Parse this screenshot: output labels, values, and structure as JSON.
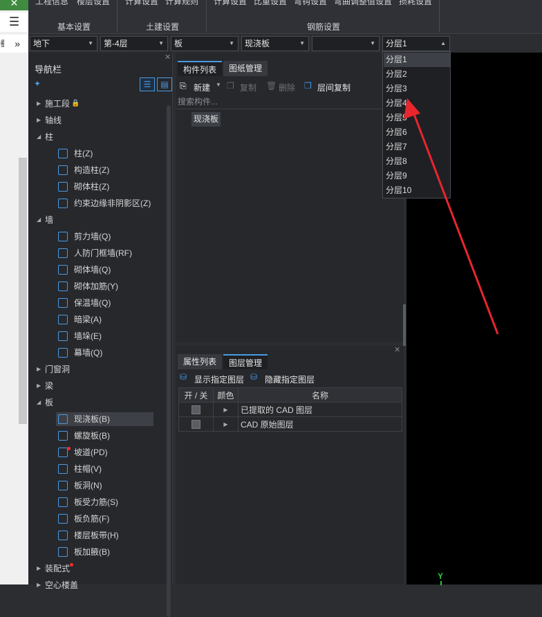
{
  "ribbon": {
    "top_items": [
      "工程信息",
      "楼层设置",
      "计算设置",
      "计算规则",
      "计算设置",
      "比重设置",
      "弯钩设置",
      "弯曲调整值设置",
      "损耗设置"
    ],
    "groups": [
      "基本设置",
      "土建设置",
      "钢筋设置"
    ]
  },
  "left_strip": {
    "top_icon": "✕",
    "menu_icon": "☰",
    "more_icon": "»",
    "edge_text": "垂"
  },
  "selectors": {
    "floor_type": "地下",
    "floor": "第-4层",
    "category": "板",
    "component": "现浇板",
    "empty": "",
    "sublayer": "分层1"
  },
  "dropdown_options": [
    "分层1",
    "分层2",
    "分层3",
    "分层4",
    "分层5",
    "分层6",
    "分层7",
    "分层8",
    "分层9",
    "分层10"
  ],
  "nav": {
    "title": "导航栏",
    "tree": [
      {
        "label": "施工段",
        "level": 0,
        "expanded": false,
        "suffix": "🔒"
      },
      {
        "label": "轴线",
        "level": 0,
        "expanded": false
      },
      {
        "label": "柱",
        "level": 0,
        "expanded": true
      },
      {
        "label": "柱(Z)",
        "level": 1
      },
      {
        "label": "构造柱(Z)",
        "level": 1
      },
      {
        "label": "砌体柱(Z)",
        "level": 1
      },
      {
        "label": "约束边缘非阴影区(Z)",
        "level": 1
      },
      {
        "label": "墙",
        "level": 0,
        "expanded": true
      },
      {
        "label": "剪力墙(Q)",
        "level": 1
      },
      {
        "label": "人防门框墙(RF)",
        "level": 1
      },
      {
        "label": "砌体墙(Q)",
        "level": 1
      },
      {
        "label": "砌体加筋(Y)",
        "level": 1
      },
      {
        "label": "保温墙(Q)",
        "level": 1
      },
      {
        "label": "暗梁(A)",
        "level": 1
      },
      {
        "label": "墙垛(E)",
        "level": 1
      },
      {
        "label": "幕墙(Q)",
        "level": 1
      },
      {
        "label": "门窗洞",
        "level": 0,
        "expanded": false
      },
      {
        "label": "梁",
        "level": 0,
        "expanded": false
      },
      {
        "label": "板",
        "level": 0,
        "expanded": true
      },
      {
        "label": "现浇板(B)",
        "level": 1,
        "selected": true
      },
      {
        "label": "螺旋板(B)",
        "level": 1
      },
      {
        "label": "坡道(PD)",
        "level": 1,
        "dot": true
      },
      {
        "label": "柱帽(V)",
        "level": 1
      },
      {
        "label": "板洞(N)",
        "level": 1
      },
      {
        "label": "板受力筋(S)",
        "level": 1
      },
      {
        "label": "板负筋(F)",
        "level": 1
      },
      {
        "label": "楼层板带(H)",
        "level": 1
      },
      {
        "label": "板加腋(B)",
        "level": 1
      },
      {
        "label": "装配式",
        "level": 0,
        "expanded": false,
        "dot": true
      },
      {
        "label": "空心楼盖",
        "level": 0,
        "expanded": false
      }
    ]
  },
  "component_panel": {
    "tabs": [
      "构件列表",
      "图纸管理"
    ],
    "toolbar": {
      "new": "新建",
      "copy": "复制",
      "delete": "删除",
      "copy_floor": "层间复制"
    },
    "search_placeholder": "搜索构件...",
    "items": [
      "现浇板"
    ]
  },
  "property_panel": {
    "tabs": [
      "属性列表",
      "图层管理"
    ],
    "show_layer": "显示指定图层",
    "hide_layer": "隐藏指定图层",
    "columns": [
      "开 / 关",
      "颜色",
      "名称"
    ],
    "rows": [
      {
        "name": "已提取的 CAD 图层"
      },
      {
        "name": "CAD 原始图层"
      }
    ]
  },
  "canvas": {
    "axis_label": "Y"
  },
  "colors": {
    "accent": "#4a9be6",
    "arrow": "#e8262e",
    "background": "#26282c"
  }
}
